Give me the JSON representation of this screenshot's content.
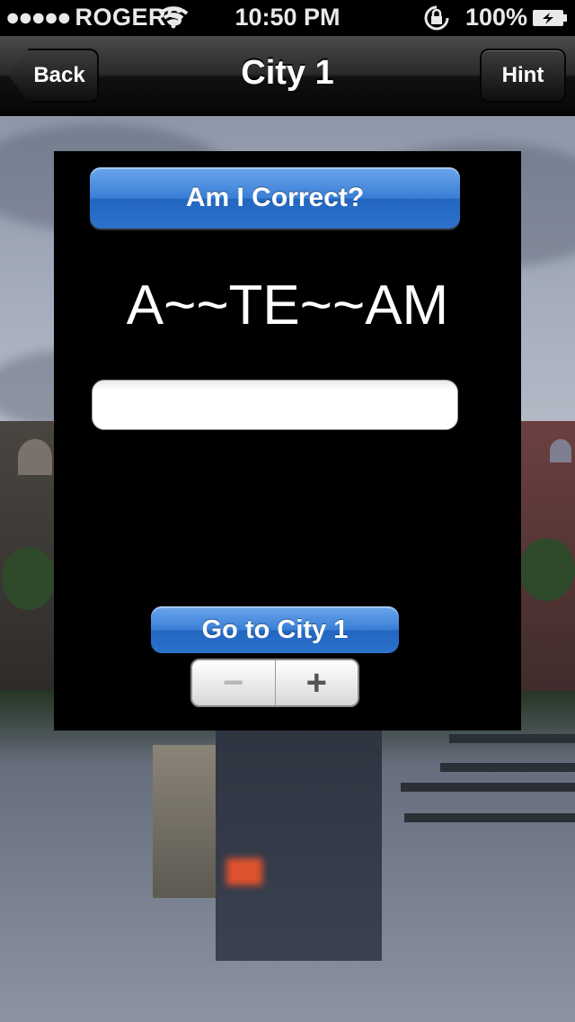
{
  "status_bar": {
    "carrier": "ROGERS",
    "signal_icon": "signal-dots-icon",
    "wifi_icon": "wifi-icon",
    "time": "10:50 PM",
    "lock_icon": "rotation-lock-icon",
    "battery_percent": "100%",
    "battery_icon": "battery-charging-icon"
  },
  "nav": {
    "title": "City 1",
    "back_label": "Back",
    "hint_label": "Hint"
  },
  "panel": {
    "check_button_label": "Am I Correct?",
    "puzzle_text": "A~~TE~~AM",
    "answer_value": "",
    "answer_placeholder": "",
    "go_button_label": "Go to City 1",
    "stepper": {
      "minus_label": "−",
      "plus_label": "+"
    }
  },
  "colors": {
    "button_blue": "#3a7fd6",
    "panel_bg": "#000000",
    "nav_bg": "#1a1a1a"
  }
}
